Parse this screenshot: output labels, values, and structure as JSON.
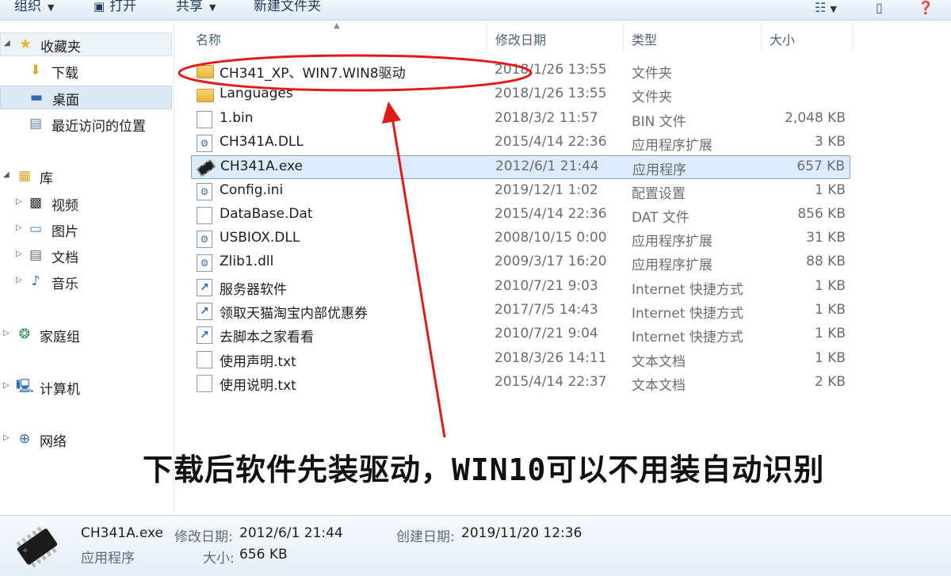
{
  "toolbar": {
    "organize": "组织",
    "open": "打开",
    "share": "共享",
    "new_folder": "新建文件夹"
  },
  "nav": {
    "favorites": "收藏夹",
    "downloads": "下载",
    "desktop": "桌面",
    "recent": "最近访问的位置",
    "libraries": "库",
    "videos": "视频",
    "pictures": "图片",
    "documents": "文档",
    "music": "音乐",
    "homegroup": "家庭组",
    "computer": "计算机",
    "network": "网络"
  },
  "columns": {
    "name": "名称",
    "date": "修改日期",
    "type": "类型",
    "size": "大小"
  },
  "files": [
    {
      "name": "CH341_XP、WIN7.WIN8驱动",
      "date": "2018/1/26 13:55",
      "type": "文件夹",
      "size": "",
      "icon": "folder-icon"
    },
    {
      "name": "Languages",
      "date": "2018/1/26 13:55",
      "type": "文件夹",
      "size": "",
      "icon": "folder-icon"
    },
    {
      "name": "1.bin",
      "date": "2018/3/2 11:57",
      "type": "BIN 文件",
      "size": "2,048 KB",
      "icon": "file-icon"
    },
    {
      "name": "CH341A.DLL",
      "date": "2015/4/14 22:36",
      "type": "应用程序扩展",
      "size": "3 KB",
      "icon": "dll-icon"
    },
    {
      "name": "CH341A.exe",
      "date": "2012/6/1 21:44",
      "type": "应用程序",
      "size": "657 KB",
      "icon": "chip-icon"
    },
    {
      "name": "Config.ini",
      "date": "2019/12/1 1:02",
      "type": "配置设置",
      "size": "1 KB",
      "icon": "settings-file-icon"
    },
    {
      "name": "DataBase.Dat",
      "date": "2015/4/14 22:36",
      "type": "DAT 文件",
      "size": "856 KB",
      "icon": "file-icon"
    },
    {
      "name": "USBIOX.DLL",
      "date": "2008/10/15 0:00",
      "type": "应用程序扩展",
      "size": "31 KB",
      "icon": "dll-icon"
    },
    {
      "name": "Zlib1.dll",
      "date": "2009/3/17 16:20",
      "type": "应用程序扩展",
      "size": "88 KB",
      "icon": "dll-icon"
    },
    {
      "name": "服务器软件",
      "date": "2010/7/21 9:03",
      "type": "Internet 快捷方式",
      "size": "1 KB",
      "icon": "shortcut-icon"
    },
    {
      "name": "领取天猫淘宝内部优惠券",
      "date": "2017/7/5 14:43",
      "type": "Internet 快捷方式",
      "size": "1 KB",
      "icon": "shortcut-icon"
    },
    {
      "name": "去脚本之家看看",
      "date": "2010/7/21 9:04",
      "type": "Internet 快捷方式",
      "size": "1 KB",
      "icon": "shortcut-icon"
    },
    {
      "name": "使用声明.txt",
      "date": "2018/3/26 14:11",
      "type": "文本文档",
      "size": "1 KB",
      "icon": "text-file-icon"
    },
    {
      "name": "使用说明.txt",
      "date": "2015/4/14 22:37",
      "type": "文本文档",
      "size": "2 KB",
      "icon": "text-file-icon"
    }
  ],
  "selected_index": 4,
  "annotation": {
    "caption": "下载后软件先装驱动，WIN10可以不用装自动识别",
    "color": "#e11b1b"
  },
  "details": {
    "filename": "CH341A.exe",
    "modified_label": "修改日期:",
    "modified_value": "2012/6/1 21:44",
    "created_label": "创建日期:",
    "created_value": "2019/11/20 12:36",
    "type": "应用程序",
    "size_label": "大小:",
    "size_value": "656 KB"
  }
}
